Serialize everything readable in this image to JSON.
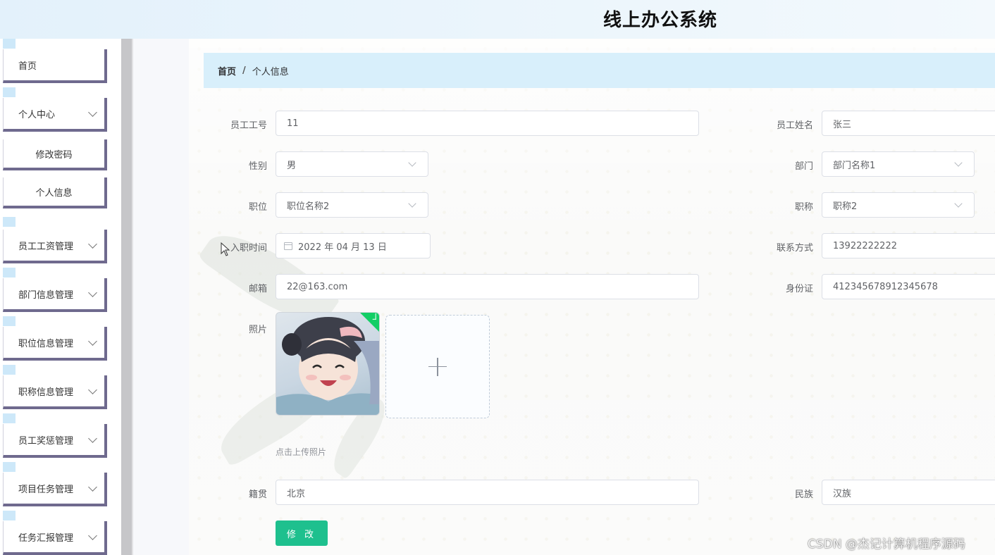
{
  "header": {
    "title": "线上办公系统"
  },
  "sidebar": {
    "items": [
      {
        "label": "首页",
        "has_arrow": false
      },
      {
        "label": "个人中心",
        "has_arrow": true
      },
      {
        "label": "修改密码",
        "has_arrow": false
      },
      {
        "label": "个人信息",
        "has_arrow": false
      },
      {
        "label": "员工工资管理",
        "has_arrow": true
      },
      {
        "label": "部门信息管理",
        "has_arrow": true
      },
      {
        "label": "职位信息管理",
        "has_arrow": true
      },
      {
        "label": "职称信息管理",
        "has_arrow": true
      },
      {
        "label": "员工奖惩管理",
        "has_arrow": true
      },
      {
        "label": "项目任务管理",
        "has_arrow": true
      },
      {
        "label": "任务汇报管理",
        "has_arrow": true
      }
    ]
  },
  "breadcrumb": {
    "home": "首页",
    "separator": "/",
    "current": "个人信息"
  },
  "form": {
    "employee_no": {
      "label": "员工工号",
      "value": "11"
    },
    "employee_name": {
      "label": "员工姓名",
      "value": "张三"
    },
    "gender": {
      "label": "性别",
      "value": "男"
    },
    "department": {
      "label": "部门",
      "value": "部门名称1"
    },
    "position": {
      "label": "职位",
      "value": "职位名称2"
    },
    "title": {
      "label": "职称",
      "value": "职称2"
    },
    "hire_date": {
      "label": "入职时间",
      "value": "2022 年 04 月 13 日"
    },
    "contact": {
      "label": "联系方式",
      "value": "13922222222"
    },
    "email": {
      "label": "邮箱",
      "value": "22@163.com"
    },
    "id_card": {
      "label": "身份证",
      "value": "412345678912345678"
    },
    "photo": {
      "label": "照片",
      "tip": "点击上传照片"
    },
    "native_place": {
      "label": "籍贯",
      "value": "北京"
    },
    "ethnicity": {
      "label": "民族",
      "value": "汉族"
    },
    "submit_label": "修 改"
  },
  "watermark": "CSDN @杰记计算机程序源码",
  "colors": {
    "accent_button": "#1ec08e",
    "breadcrumb_bg": "#d8effb",
    "sidebar_border": "#6f6a8e",
    "upload_success": "#13ce66"
  }
}
